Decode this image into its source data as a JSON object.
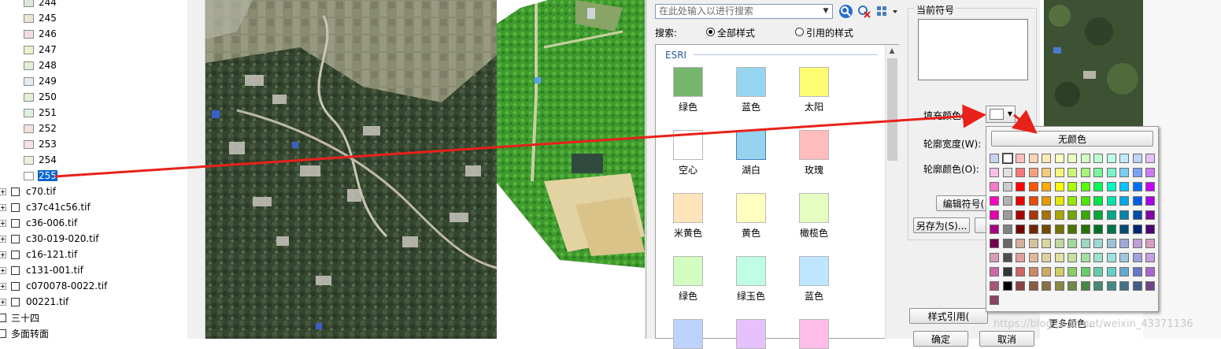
{
  "tree": {
    "value_rows": [
      {
        "label": "244",
        "color": "#dde7d5"
      },
      {
        "label": "245",
        "color": "#ece6d2"
      },
      {
        "label": "246",
        "color": "#f1dbe6"
      },
      {
        "label": "247",
        "color": "#eef0cf"
      },
      {
        "label": "248",
        "color": "#e2eed6"
      },
      {
        "label": "249",
        "color": "#e4ebf0"
      },
      {
        "label": "250",
        "color": "#e3efd6"
      },
      {
        "label": "251",
        "color": "#dfefdf"
      },
      {
        "label": "252",
        "color": "#f0e4de"
      },
      {
        "label": "253",
        "color": "#f3e3ea"
      },
      {
        "label": "254",
        "color": "#f0f0dc"
      },
      {
        "label": "255",
        "color": "#ffffff",
        "selected": true
      }
    ],
    "layers": [
      "c70.tif",
      "c37c41c56.tif",
      "c36-006.tif",
      "c30-019-020.tif",
      "c16-121.tif",
      "c131-001.tif",
      "c070078-0022.tif",
      "00221.tif"
    ],
    "groups": [
      "三十四",
      "多面转面"
    ]
  },
  "dialog": {
    "search_placeholder": "在此处输入以进行搜索",
    "search_label": "搜索:",
    "radio_all": "全部样式",
    "radio_ref": "引用的样式",
    "gallery_header": "ESRI",
    "symbols": [
      {
        "name": "绿色",
        "color": "#76b56d"
      },
      {
        "name": "蓝色",
        "color": "#96d6f0"
      },
      {
        "name": "太阳",
        "color": "#fffd74"
      },
      {
        "name": "空心",
        "color": "#ffffff"
      },
      {
        "name": "湖白",
        "color": "#96d3ef"
      },
      {
        "name": "玫瑰",
        "color": "#ffbcbc"
      },
      {
        "name": "米黄色",
        "color": "#ffe4b9"
      },
      {
        "name": "黄色",
        "color": "#ffffbf"
      },
      {
        "name": "橄榄色",
        "color": "#e6fdc0"
      },
      {
        "name": "绿色",
        "color": "#d2fdbe"
      },
      {
        "name": "绿玉色",
        "color": "#bffde5"
      },
      {
        "name": "蓝色",
        "color": "#bfe6ff"
      },
      {
        "name": "",
        "color": "#bcd3fd"
      },
      {
        "name": "",
        "color": "#e6c2fd"
      },
      {
        "name": "",
        "color": "#fdbde8"
      }
    ],
    "current_symbol_label": "当前符号",
    "fill_color_label": "填充颜色(F):",
    "outline_width_label": "轮廓宽度(W):",
    "outline_color_label": "轮廓颜色(O):",
    "edit_symbol_button": "编辑符号(",
    "save_as_button": "另存为(S)...",
    "style_ref_button": "样式引用(",
    "ok_button": "确定",
    "cancel_button": "取消"
  },
  "color_popup": {
    "no_color": "无颜色",
    "more_colors": "更多颜色...",
    "rows": [
      [
        "#c5d4f0",
        "#ffffff",
        "#ffbebe",
        "#ffd3b4",
        "#ffe9b4",
        "#ffffbe",
        "#e9ffbe",
        "#d3ffbe",
        "#beffd4",
        "#beffe9",
        "#bee9ff",
        "#bed3ff",
        "#e9beff"
      ],
      [
        "#ffbee8",
        "#e1e1e1",
        "#f57a7a",
        "#f5a27a",
        "#f5ca7a",
        "#f5f57a",
        "#cdf57a",
        "#a5f57a",
        "#7af5a0",
        "#7af5ca",
        "#7acdf5",
        "#7aa2f5",
        "#ca7af5"
      ],
      [
        "#f57ac9",
        "#cccccc",
        "#ff0000",
        "#ff5500",
        "#ffaa00",
        "#ffff00",
        "#aaff00",
        "#55ff00",
        "#00ff55",
        "#00ffc5",
        "#00c5ff",
        "#0070ff",
        "#c500ff"
      ],
      [
        "#ff00c5",
        "#b2b2b2",
        "#e60000",
        "#e64c00",
        "#e69800",
        "#e6e600",
        "#98e600",
        "#4ce600",
        "#00e64c",
        "#00e6a9",
        "#00a9e6",
        "#005ce6",
        "#a900e6"
      ],
      [
        "#e600a9",
        "#9c9c9c",
        "#a80000",
        "#a83800",
        "#a87000",
        "#a8a800",
        "#70a800",
        "#38a800",
        "#00a838",
        "#00a884",
        "#0084a8",
        "#004da8",
        "#8400a8"
      ],
      [
        "#a80084",
        "#828282",
        "#730000",
        "#732600",
        "#734c00",
        "#737300",
        "#4c7300",
        "#267300",
        "#007326",
        "#00734c",
        "#004c73",
        "#002673",
        "#4c0073"
      ],
      [
        "#73004c",
        "#686868",
        "#d7b09e",
        "#d7c29e",
        "#d7d79e",
        "#c2d79e",
        "#a3d79e",
        "#9ed7c2",
        "#9ed7d7",
        "#9ec2d7",
        "#9eaad7",
        "#c29ed7",
        "#d79ec2"
      ],
      [
        "#d69dbc",
        "#4e4e4e",
        "#e1a0a0",
        "#e1b89e",
        "#e1d09e",
        "#e1e19e",
        "#c8e19e",
        "#a0e1a0",
        "#9ee1c8",
        "#9ee1e1",
        "#9ec8e1",
        "#a0a0e1",
        "#c89ee1"
      ],
      [
        "#cd66aa",
        "#343434",
        "#cd6666",
        "#cd8966",
        "#cdaa66",
        "#cdcd66",
        "#89cd66",
        "#66cd66",
        "#66cdab",
        "#66cdcd",
        "#66a9cd",
        "#6677cd",
        "#a966cd"
      ],
      [
        "#a9567a",
        "#000000",
        "#894444",
        "#895a44",
        "#897044",
        "#898944",
        "#708944",
        "#448944",
        "#448970",
        "#448989",
        "#447089",
        "#445c89",
        "#704489"
      ],
      [
        "#894465"
      ]
    ]
  },
  "watermark": "https://blog.csdn.net/weixin_43371136"
}
